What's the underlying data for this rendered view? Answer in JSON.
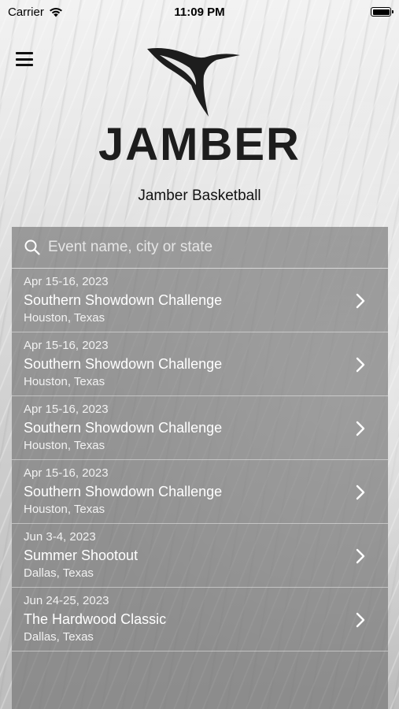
{
  "status_bar": {
    "carrier": "Carrier",
    "time": "11:09 PM"
  },
  "header": {
    "menu_icon": "hamburger-menu-icon",
    "logo_icon": "hummingbird-logo-icon",
    "brand": "JAMBER",
    "organization": "Jamber Basketball"
  },
  "search": {
    "placeholder": "Event name, city or state",
    "value": ""
  },
  "events": [
    {
      "date": "Apr 15-16, 2023",
      "name": "Southern Showdown Challenge",
      "location": "Houston, Texas"
    },
    {
      "date": "Apr 15-16, 2023",
      "name": "Southern Showdown Challenge",
      "location": "Houston, Texas"
    },
    {
      "date": "Apr 15-16, 2023",
      "name": "Southern Showdown Challenge",
      "location": "Houston, Texas"
    },
    {
      "date": "Apr 15-16, 2023",
      "name": "Southern Showdown Challenge",
      "location": "Houston, Texas"
    },
    {
      "date": "Jun 3-4, 2023",
      "name": "Summer Shootout",
      "location": "Dallas, Texas"
    },
    {
      "date": "Jun 24-25, 2023",
      "name": "The Hardwood Classic",
      "location": "Dallas, Texas"
    }
  ],
  "colors": {
    "panel": "#6e6e6e",
    "text_light": "#ffffff",
    "brand_text": "#1d1d1d"
  }
}
